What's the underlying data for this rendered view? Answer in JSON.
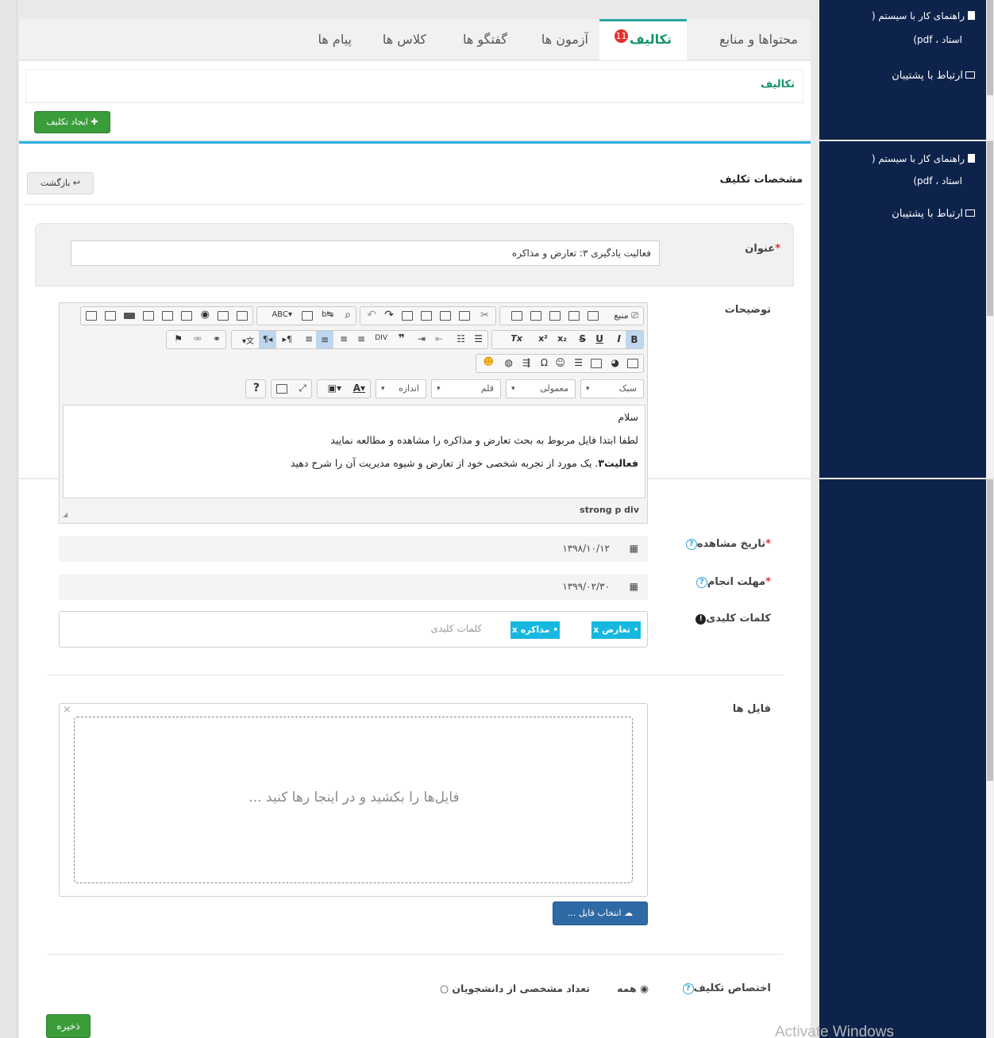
{
  "sidebar": {
    "guide_line1": "راهنمای کار با سیستم (",
    "guide_line2": "استاد ، pdf)",
    "support": "ارتباط با پشتیبان"
  },
  "tabs": [
    {
      "label": "محتواها و منابع",
      "active": false
    },
    {
      "label": "تکالیف",
      "active": true,
      "badge": "11"
    },
    {
      "label": "آزمون ها",
      "active": false
    },
    {
      "label": "گفتگو ها",
      "active": false
    },
    {
      "label": "کلاس ها",
      "active": false
    },
    {
      "label": "پیام ها",
      "active": false
    }
  ],
  "assignments": {
    "heading": "تکالیف",
    "create_button": "ایجاد تکلیف"
  },
  "form": {
    "header": "مشخصات تکلیف",
    "back_button": "بازگشت",
    "title_label": "عنوان",
    "title_value": "فعالیت یادگیری ۳: تعارض و مذاکره",
    "desc_label": "توضیحات",
    "editor": {
      "combo_style": "سبک",
      "combo_format": "معمولی",
      "combo_font": "قلم",
      "combo_size": "اندازه",
      "source_label": "منبع",
      "line1": "سلام",
      "line2": "لطفا ابتدا فایل مربوط به بحث تعارض و مذاکره را مشاهده و مطالعه نمایید",
      "line3_bold": "فعالیت۳",
      "line3_rest": ". یک مورد از تجربه شخصی خود از تعارض و شیوه مدیریت آن را شرح دهید",
      "path": "strong  p  div"
    },
    "view_date_label": "تاریخ مشاهده",
    "view_date_value": "۱۳۹۸/۱۰/۱۲",
    "deadline_label": "مهلت انجام",
    "deadline_value": "۱۳۹۹/۰۲/۳۰",
    "keywords_label": "کلمات کلیدی",
    "keywords": [
      "تعارض",
      "مذاکره"
    ],
    "keywords_placeholder": "کلمات کلیدی",
    "files_label": "فایل ها",
    "dropzone_text": "فایل‌ها را بکشید و در اینجا رها کنید ...",
    "choose_file_button": "انتخاب فایل ...",
    "assign_label": "اختصاص تکلیف",
    "assign_all": "همه",
    "assign_specific": "تعداد مشخصی از دانشجویان",
    "save_button": "ذخیره"
  },
  "watermark": "Activate Windows"
}
